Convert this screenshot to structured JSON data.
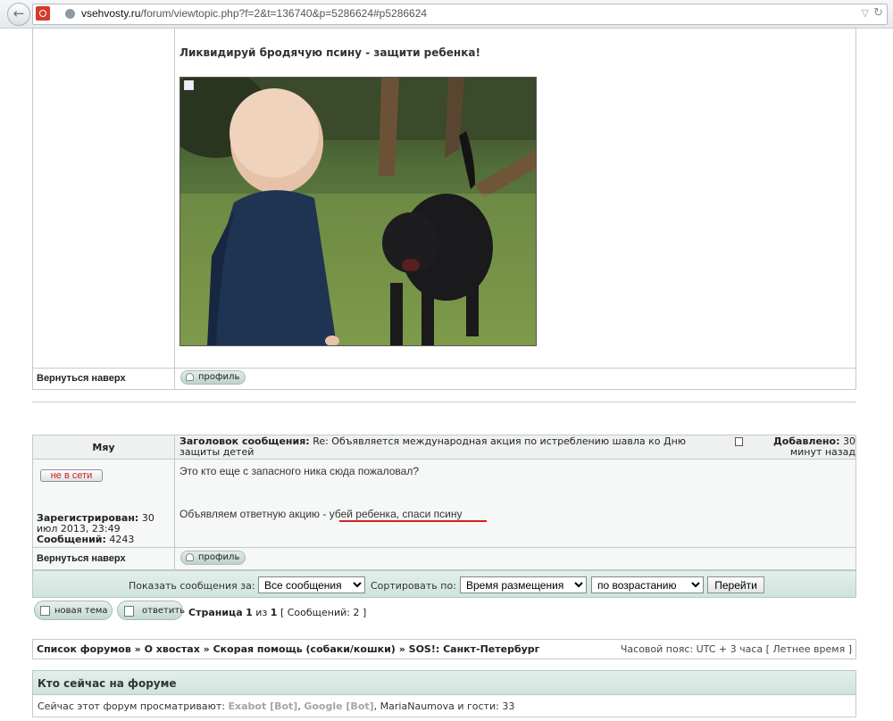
{
  "browser": {
    "url_host": "vsehvosty.ru",
    "url_path": "/forum/viewtopic.php?f=2&t=136740&p=5286624#p5286624"
  },
  "post1": {
    "title": "Ликвидируй бродячую псину - защити ребенка!",
    "back_to_top": "Вернуться наверх",
    "profile": "профиль"
  },
  "post2": {
    "author": "Мяу",
    "subject_label": "Заголовок сообщения:",
    "subject": "Re: Объявляется международная акция по истреблению шавла ко Дню защиты детей",
    "added_label": "Добавлено:",
    "added_time": "30 минут назад",
    "status_badge": "не в сети",
    "registered_label": "Зарегистрирован:",
    "registered_value": "30 июл 2013, 23:49",
    "messages_label": "Сообщений:",
    "messages_value": "4243",
    "line1": "Это кто еще с запасного ника сюда пожаловал?",
    "line2_prefix": "Объявляем ответную акцию - ",
    "line2_highlight": "убей ребенка, спаси псину",
    "back_to_top": "Вернуться наверх",
    "profile": "профиль",
    "underline_color": "#d81e1e"
  },
  "sortbar": {
    "show_label": "Показать сообщения за:",
    "show_value": "Все сообщения",
    "sort_label": "Сортировать по:",
    "sort_value": "Время размещения",
    "order_value": "по возрастанию",
    "go_button": "Перейти"
  },
  "actions": {
    "new_topic": "новая тема",
    "reply": "ответить",
    "page_prefix": "Страница",
    "page_current": "1",
    "page_of": "из",
    "page_total": "1",
    "messages_count": "[ Сообщений: 2 ]"
  },
  "breadcrumb": {
    "items": [
      "Список форумов",
      "О хвостах",
      "Скорая помощь (собаки/кошки)",
      "SOS!: Санкт-Петербург"
    ],
    "sep": "»",
    "timezone": "Часовой пояс: UTC + 3 часа [ Летнее время ]"
  },
  "online": {
    "header": "Кто сейчас на форуме",
    "prefix": "Сейчас этот форум просматривают:",
    "bot1": "Exabot [Bot]",
    "bot2": "Google [Bot]",
    "user": "MariaNaumova",
    "suffix": "и гости: 33"
  },
  "colors": {
    "teal_bar": "#cfe3dc",
    "border": "#c5c9cc",
    "badge_red": "#d61a1a",
    "bot_gray": "#a6a6a6"
  }
}
